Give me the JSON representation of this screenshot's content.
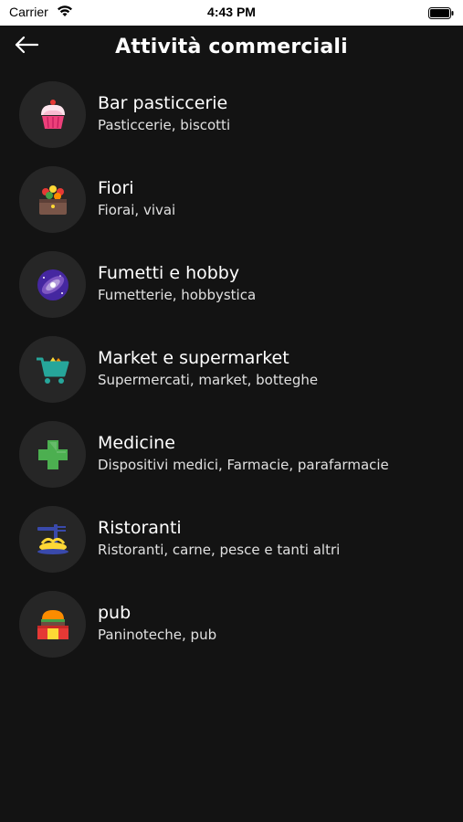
{
  "status_bar": {
    "carrier": "Carrier",
    "time": "4:43 PM"
  },
  "header": {
    "title": "Attività commerciali",
    "back_icon": "arrow-left-icon"
  },
  "categories": [
    {
      "title": "Bar pasticcerie",
      "subtitle": "Pasticcerie, biscotti",
      "icon": "cupcake-icon"
    },
    {
      "title": "Fiori",
      "subtitle": "Fiorai, vivai",
      "icon": "flowers-icon"
    },
    {
      "title": "Fumetti e hobby",
      "subtitle": "Fumetterie, hobbystica",
      "icon": "galaxy-icon"
    },
    {
      "title": "Market e supermarket",
      "subtitle": "Supermercati, market, botteghe",
      "icon": "shopping-cart-icon"
    },
    {
      "title": "Medicine",
      "subtitle": "Dispositivi medici, Farmacie, parafarmacie",
      "icon": "medical-cross-icon"
    },
    {
      "title": "Ristoranti",
      "subtitle": "Ristoranti, carne, pesce e tanti altri",
      "icon": "spaghetti-icon"
    },
    {
      "title": "pub",
      "subtitle": "Paninoteche, pub",
      "icon": "burger-icon"
    }
  ],
  "colors": {
    "background": "#131313",
    "icon_circle": "#262626",
    "text": "#ffffff"
  }
}
